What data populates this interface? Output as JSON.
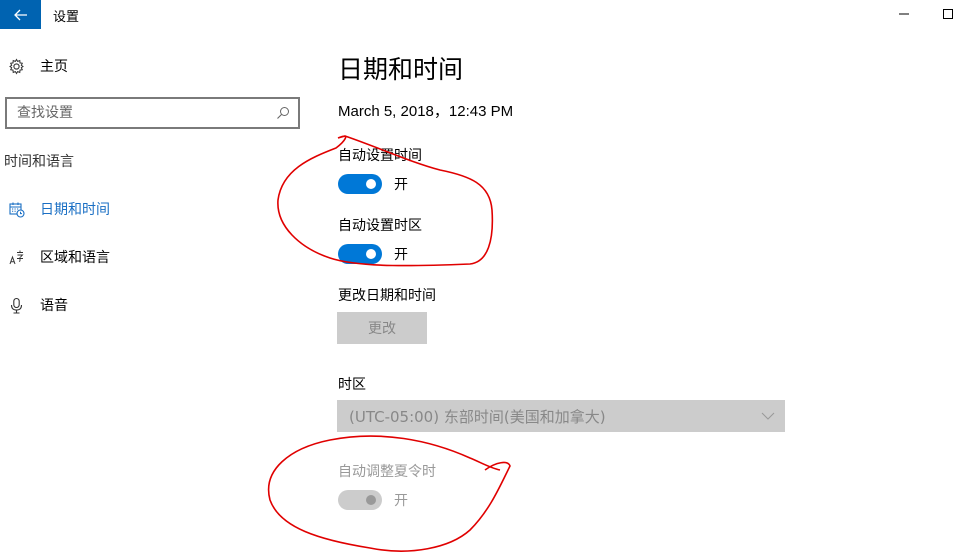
{
  "window": {
    "title": "设置",
    "back_icon": "arrow-left-icon",
    "minimize_icon": "minimize-icon",
    "maximize_icon": "maximize-icon"
  },
  "sidebar": {
    "home": {
      "label": "主页",
      "icon": "gear-icon"
    },
    "search": {
      "placeholder": "查找设置",
      "value": "",
      "icon": "search-icon"
    },
    "section_title": "时间和语言",
    "items": [
      {
        "label": "日期和时间",
        "icon": "calendar-clock-icon",
        "active": true
      },
      {
        "label": "区域和语言",
        "icon": "language-icon",
        "active": false
      },
      {
        "label": "语音",
        "icon": "microphone-icon",
        "active": false
      }
    ]
  },
  "main": {
    "title": "日期和时间",
    "current_datetime": "March 5, 2018，12:43 PM",
    "auto_time": {
      "label": "自动设置时间",
      "state": "开",
      "on": true
    },
    "auto_timezone": {
      "label": "自动设置时区",
      "state": "开",
      "on": true
    },
    "change_datetime": {
      "label": "更改日期和时间",
      "button_label": "更改",
      "enabled": false
    },
    "timezone": {
      "label": "时区",
      "selected": "(UTC-05:00) 东部时间(美国和加拿大)",
      "enabled": false
    },
    "dst": {
      "label": "自动调整夏令时",
      "state": "开",
      "enabled": false
    }
  },
  "colors": {
    "accent": "#0078d7",
    "back_button": "#0063b1",
    "active_nav": "#1a6fc4",
    "disabled_bg": "#cccccc",
    "annotation_red": "#e00000"
  }
}
